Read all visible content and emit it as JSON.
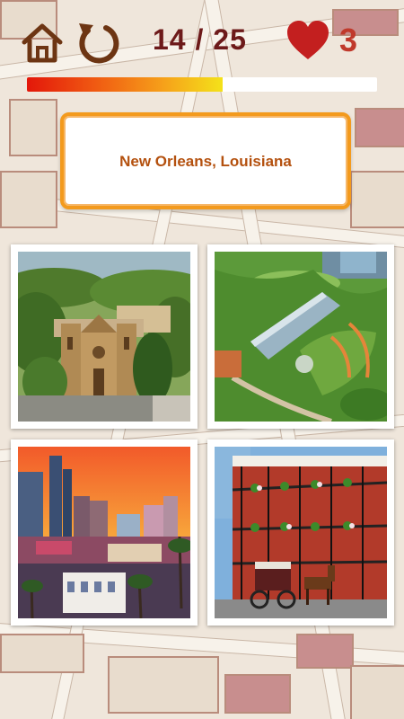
{
  "header": {
    "home_icon": "home-icon",
    "restart_icon": "restart-icon",
    "score": "14 / 25",
    "lives_icon": "heart-icon",
    "lives": "3"
  },
  "progress": {
    "current": 14,
    "total": 25,
    "fraction": 0.56
  },
  "question": {
    "text": "New Orleans, Louisiana"
  },
  "options": [
    {
      "id": 1,
      "scene": "cathedral-adobe-city"
    },
    {
      "id": 2,
      "scene": "aerial-park-conservatory"
    },
    {
      "id": 3,
      "scene": "sunset-city-skyline"
    },
    {
      "id": 4,
      "scene": "french-quarter-balconies-carriage"
    }
  ],
  "colors": {
    "accent": "#f39a1d",
    "score": "#6d1a1a",
    "heart": "#c0392b",
    "question_text": "#b4510f"
  }
}
